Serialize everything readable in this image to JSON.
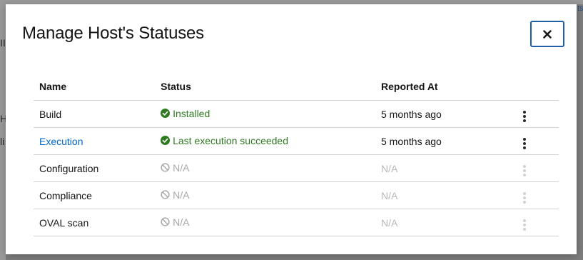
{
  "background": {
    "link_fragment": "ts",
    "text_fragments": [
      "II",
      "H",
      "li"
    ]
  },
  "modal": {
    "title": "Manage Host's Statuses",
    "close_label": "×"
  },
  "table": {
    "headers": {
      "name": "Name",
      "status": "Status",
      "reported_at": "Reported At"
    },
    "rows": [
      {
        "name": "Build",
        "name_is_link": false,
        "status": "Installed",
        "status_type": "success",
        "reported_at": "5 months ago",
        "actions_enabled": true
      },
      {
        "name": "Execution",
        "name_is_link": true,
        "status": "Last execution succeeded",
        "status_type": "success",
        "reported_at": "5 months ago",
        "actions_enabled": true
      },
      {
        "name": "Configuration",
        "name_is_link": false,
        "status": "N/A",
        "status_type": "na",
        "reported_at": "N/A",
        "actions_enabled": false
      },
      {
        "name": "Compliance",
        "name_is_link": false,
        "status": "N/A",
        "status_type": "na",
        "reported_at": "N/A",
        "actions_enabled": false
      },
      {
        "name": "OVAL scan",
        "name_is_link": false,
        "status": "N/A",
        "status_type": "na",
        "reported_at": "N/A",
        "actions_enabled": false
      }
    ]
  },
  "colors": {
    "success": "#2f7a21",
    "link": "#0066cc",
    "disabled": "#a8a8a8",
    "close_border": "#1f5fa8"
  },
  "icons": {
    "success": "check-circle-icon",
    "na": "ban-icon",
    "actions": "kebab-menu-icon",
    "close": "close-icon"
  }
}
